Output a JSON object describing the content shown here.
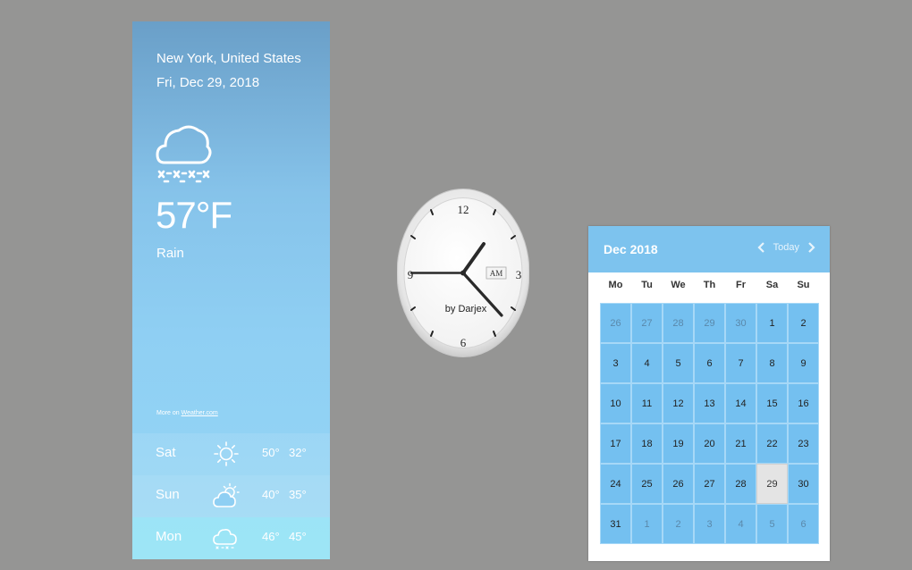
{
  "weather": {
    "location": "New York, United States",
    "date": "Fri, Dec 29, 2018",
    "icon": "cloud-rain-icon",
    "temperature": "57°F",
    "condition": "Rain",
    "more_prefix": "More on ",
    "more_link": "Weather.com",
    "forecast": [
      {
        "day": "Sat",
        "icon": "sun-icon",
        "high": "50°",
        "low": "32°"
      },
      {
        "day": "Sun",
        "icon": "partly-cloudy-icon",
        "high": "40°",
        "low": "35°"
      },
      {
        "day": "Mon",
        "icon": "cloud-rain-icon",
        "high": "46°",
        "low": "45°"
      }
    ]
  },
  "clock": {
    "numerals": {
      "twelve": "12",
      "three": "3",
      "six": "6",
      "nine": "9"
    },
    "ampm": "AM",
    "credit": "by Darjex"
  },
  "calendar": {
    "title": "Dec 2018",
    "today_label": "Today",
    "weekdays": [
      "Mo",
      "Tu",
      "We",
      "Th",
      "Fr",
      "Sa",
      "Su"
    ],
    "days": [
      {
        "d": "26",
        "muted": true
      },
      {
        "d": "27",
        "muted": true
      },
      {
        "d": "28",
        "muted": true
      },
      {
        "d": "29",
        "muted": true
      },
      {
        "d": "30",
        "muted": true
      },
      {
        "d": "1"
      },
      {
        "d": "2"
      },
      {
        "d": "3"
      },
      {
        "d": "4"
      },
      {
        "d": "5"
      },
      {
        "d": "6"
      },
      {
        "d": "7"
      },
      {
        "d": "8"
      },
      {
        "d": "9"
      },
      {
        "d": "10"
      },
      {
        "d": "11"
      },
      {
        "d": "12"
      },
      {
        "d": "13"
      },
      {
        "d": "14"
      },
      {
        "d": "15"
      },
      {
        "d": "16"
      },
      {
        "d": "17"
      },
      {
        "d": "18"
      },
      {
        "d": "19"
      },
      {
        "d": "20"
      },
      {
        "d": "21"
      },
      {
        "d": "22"
      },
      {
        "d": "23"
      },
      {
        "d": "24"
      },
      {
        "d": "25"
      },
      {
        "d": "26"
      },
      {
        "d": "27"
      },
      {
        "d": "28"
      },
      {
        "d": "29",
        "today": true
      },
      {
        "d": "30"
      },
      {
        "d": "31"
      },
      {
        "d": "1",
        "muted": true
      },
      {
        "d": "2",
        "muted": true
      },
      {
        "d": "3",
        "muted": true
      },
      {
        "d": "4",
        "muted": true
      },
      {
        "d": "5",
        "muted": true
      },
      {
        "d": "6",
        "muted": true
      }
    ]
  },
  "colors": {
    "background": "#959594",
    "calendar_accent": "#7dc3ee",
    "calendar_cell": "#74c0f0",
    "calendar_today": "#e4e4e4"
  }
}
